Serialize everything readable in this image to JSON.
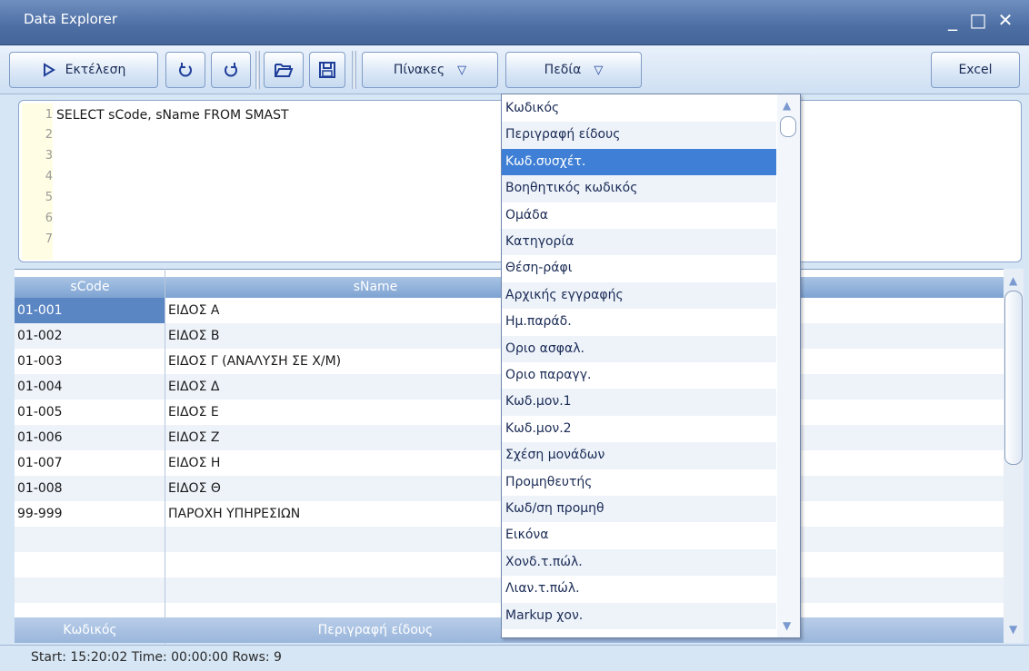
{
  "window": {
    "title": "Data Explorer"
  },
  "toolbar": {
    "run_label": "Εκτέλεση",
    "tables_label": "Πίνακες",
    "fields_label": "Πεδία",
    "excel_label": "Excel"
  },
  "editor": {
    "line_numbers": [
      "1",
      "2",
      "3",
      "4",
      "5",
      "6",
      "7"
    ],
    "sql": "SELECT sCode, sName FROM SMAST"
  },
  "grid": {
    "columns": [
      "sCode",
      "sName"
    ],
    "footer": [
      "Κωδικός",
      "Περιγραφή είδους"
    ],
    "rows": [
      [
        "01-001",
        "ΕΙΔΟΣ Α"
      ],
      [
        "01-002",
        "ΕΙΔΟΣ Β"
      ],
      [
        "01-003",
        "ΕΙΔΟΣ Γ (ΑΝΑΛΥΣΗ ΣΕ Χ/Μ)"
      ],
      [
        "01-004",
        "ΕΙΔΟΣ Δ"
      ],
      [
        "01-005",
        "ΕΙΔΟΣ Ε"
      ],
      [
        "01-006",
        "ΕΙΔΟΣ Ζ"
      ],
      [
        "01-007",
        "ΕΙΔΟΣ Η"
      ],
      [
        "01-008",
        "ΕΙΔΟΣ Θ"
      ],
      [
        "99-999",
        "ΠΑΡΟΧΗ ΥΠΗΡΕΣΙΩΝ"
      ]
    ]
  },
  "fields_dropdown": {
    "selected_index": 2,
    "items": [
      "Κωδικός",
      "Περιγραφή είδους",
      "Κωδ.συσχέτ.",
      "Βοηθητικός κωδικός",
      "Ομάδα",
      "Κατηγορία",
      "Θέση-ράφι",
      "Αρχικής εγγραφής",
      "Ημ.παράδ.",
      "Οριο ασφαλ.",
      "Οριο παραγγ.",
      "Κωδ.μον.1",
      "Κωδ.μον.2",
      "Σχέση μονάδων",
      "Προμηθευτής",
      "Κωδ/ση προμηθ",
      "Εικόνα",
      "Χονδ.τ.πώλ.",
      "Λιαν.τ.πώλ.",
      "Markup χον."
    ]
  },
  "status": {
    "text": "Start: 15:20:02  Time: 00:00:00  Rows: 9"
  },
  "colors": {
    "selection": "#3f7fd5",
    "title_bar": "#4d6ea3",
    "header": "#7ea3d2"
  },
  "icons": [
    "play-icon",
    "undo-icon",
    "redo-icon",
    "folder-open-icon",
    "save-icon",
    "chevron-down-icon",
    "minimize-icon",
    "maximize-icon",
    "close-icon"
  ]
}
